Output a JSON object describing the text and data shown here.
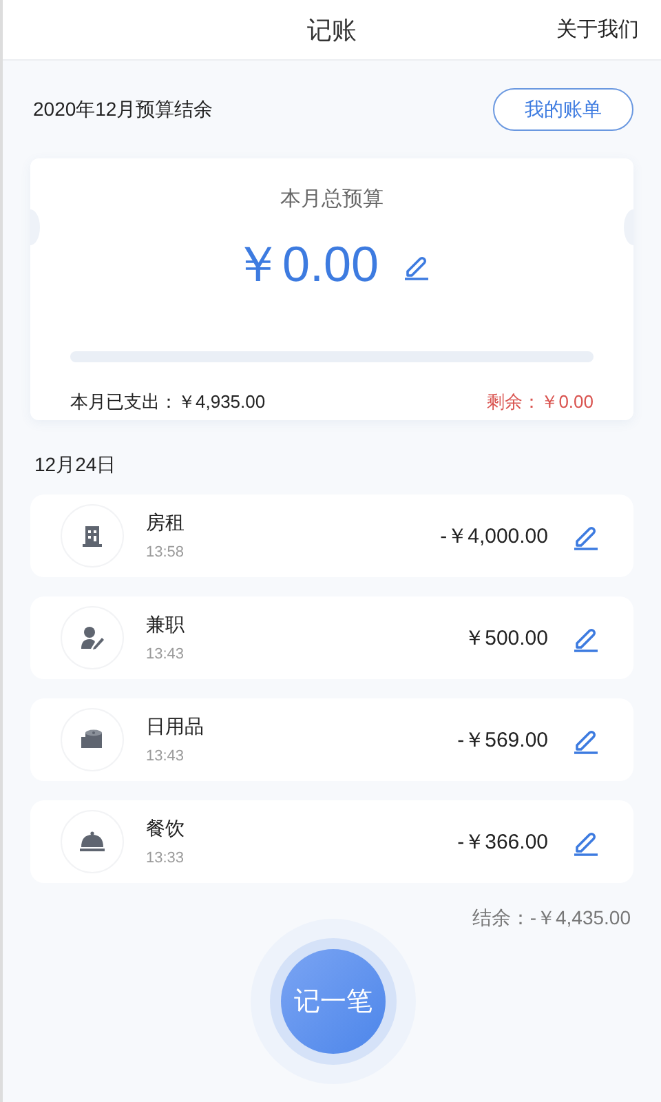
{
  "header": {
    "title": "记账",
    "about_link": "关于我们"
  },
  "budget_period": "2020年12月预算结余",
  "bills_button": "我的账单",
  "budget_card": {
    "label": "本月总预算",
    "amount": "￥0.00",
    "level": 0,
    "spent": "本月已支出：￥4,935.00",
    "remaining": "剩余：￥0.00"
  },
  "date_heading": "12月24日",
  "entries": [
    {
      "kind": "building",
      "category": "房租",
      "time": "13:58",
      "amount": "-￥4,000.00"
    },
    {
      "kind": "person",
      "category": "兼职",
      "time": "13:43",
      "amount": "￥500.00"
    },
    {
      "kind": "roll",
      "category": "日用品",
      "time": "13:43",
      "amount": "-￥569.00"
    },
    {
      "kind": "cloche",
      "category": "餐饮",
      "time": "13:33",
      "amount": "-￥366.00"
    }
  ],
  "balance": "结余：-￥4,435.00",
  "add_button": "记一笔"
}
